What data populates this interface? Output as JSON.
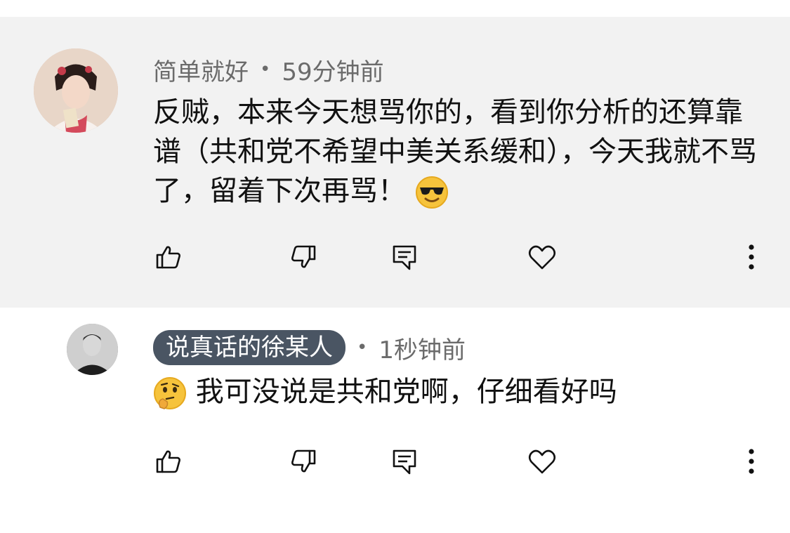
{
  "comments": [
    {
      "author": "简单就好",
      "separator": "•",
      "time": "59分钟前",
      "text": "反贼，本来今天想骂你的，看到你分析的还算靠谱（共和党不希望中美关系缓和），今天我就不骂了，留着下次再骂！",
      "emoji_trailing": "smiling-face-with-sunglasses-emoji",
      "avatar": "avatar-costume-portrait"
    },
    {
      "author": "说真话的徐某人",
      "author_highlighted": true,
      "separator": "•",
      "time": "1秒钟前",
      "emoji_leading": "thinking-face-emoji",
      "text": "我可没说是共和党啊，仔细看好吗",
      "avatar": "avatar-man-portrait"
    }
  ],
  "actions": {
    "like_icon": "thumbs-up-icon",
    "dislike_icon": "thumbs-down-icon",
    "reply_icon": "comment-icon",
    "heart_icon": "heart-icon",
    "more_icon": "more-vertical-icon"
  },
  "colors": {
    "highlight_background": "#f2f2f2",
    "author_pill": "#4a5563",
    "meta_text": "#6b6b6b",
    "body_text": "#111111"
  }
}
